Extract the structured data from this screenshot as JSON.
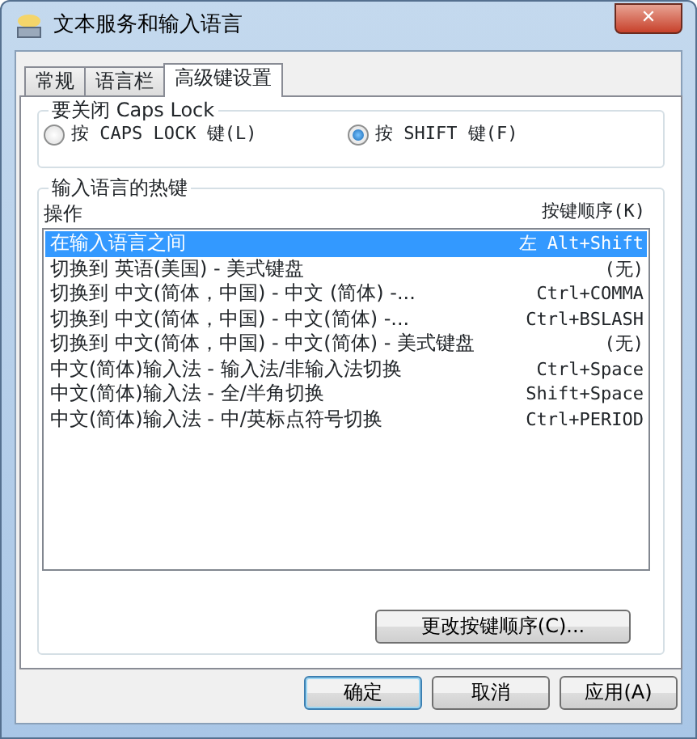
{
  "window": {
    "title": "文本服务和输入语言",
    "close": "✕"
  },
  "tabs": [
    {
      "label": "常规",
      "selected": false
    },
    {
      "label": "语言栏",
      "selected": false
    },
    {
      "label": "高级键设置",
      "selected": true
    }
  ],
  "caps_lock": {
    "title": "要关闭 Caps Lock",
    "options": [
      {
        "label": "按 CAPS LOCK 键(L)",
        "selected": false
      },
      {
        "label": "按 SHIFT 键(F)",
        "selected": true
      }
    ]
  },
  "hotkeys": {
    "title": "输入语言的热键",
    "columns": [
      "操作",
      "按键顺序(K)"
    ],
    "rows": [
      {
        "action": "在输入语言之间",
        "keys": "左 Alt+Shift",
        "selected": true
      },
      {
        "action": "切换到 英语(美国) - 美式键盘",
        "keys": "(无)",
        "selected": false
      },
      {
        "action": "切换到 中文(简体，中国) - 中文 (简体) -...",
        "keys": "Ctrl+COMMA",
        "selected": false
      },
      {
        "action": "切换到 中文(简体，中国) - 中文(简体) -...",
        "keys": "Ctrl+BSLASH",
        "selected": false
      },
      {
        "action": "切换到 中文(简体，中国) - 中文(简体) - 美式键盘",
        "keys": "(无)",
        "selected": false
      },
      {
        "action": "中文(简体)输入法 - 输入法/非输入法切换",
        "keys": "Ctrl+Space",
        "selected": false
      },
      {
        "action": "中文(简体)输入法 - 全/半角切换",
        "keys": "Shift+Space",
        "selected": false
      },
      {
        "action": "中文(简体)输入法 - 中/英标点符号切换",
        "keys": "Ctrl+PERIOD",
        "selected": false
      }
    ],
    "change_button": "更改按键顺序(C)..."
  },
  "buttons": [
    {
      "label": "确定",
      "default": true
    },
    {
      "label": "取消",
      "default": false
    },
    {
      "label": "应用(A)",
      "default": false
    }
  ]
}
